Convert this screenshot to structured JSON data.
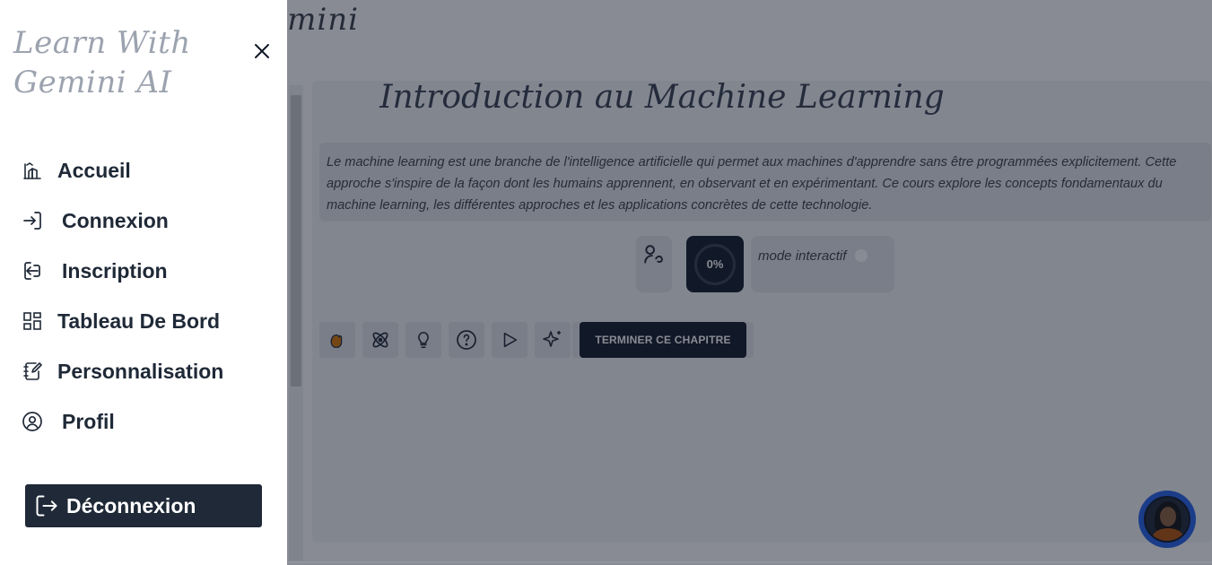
{
  "background": {
    "header_title_fragment": "mini",
    "course_title": "Introduction au Machine Learning",
    "description": "Le machine learning est une branche de l'intelligence artificielle qui permet aux machines d'apprendre sans être programmées explicitement. Cette approche s'inspire de la façon dont les humains apprennent, en observant et en expérimentant. Ce cours explore les concepts fondamentaux du machine learning, les différentes approches et les applications concrètes de cette technologie.",
    "progress_label": "0%",
    "progress_value": 0,
    "mode_label": "mode interactif",
    "finish_button": "TERMINER CE CHAPITRE",
    "tool_icons": [
      "hand-icon",
      "atom-icon",
      "lightbulb-icon",
      "help-circle-icon",
      "play-icon",
      "sparkles-icon"
    ]
  },
  "drawer": {
    "brand_line1": "Learn With",
    "brand_line2": "Gemini AI",
    "items": [
      {
        "label": "Accueil",
        "icon": "home-chart-icon"
      },
      {
        "label": "Connexion",
        "icon": "login-icon"
      },
      {
        "label": "Inscription",
        "icon": "signup-icon"
      },
      {
        "label": "Tableau De Bord",
        "icon": "dashboard-icon"
      },
      {
        "label": "Personnalisation",
        "icon": "edit-notebook-icon"
      },
      {
        "label": "Profil",
        "icon": "user-circle-icon"
      }
    ],
    "logout_label": "Déconnexion"
  },
  "colors": {
    "drawer_bg": "#ffffff",
    "dark": "#1f2937",
    "overlay": "rgba(17,24,39,0.5)",
    "avatar_ring": "#2563eb"
  }
}
